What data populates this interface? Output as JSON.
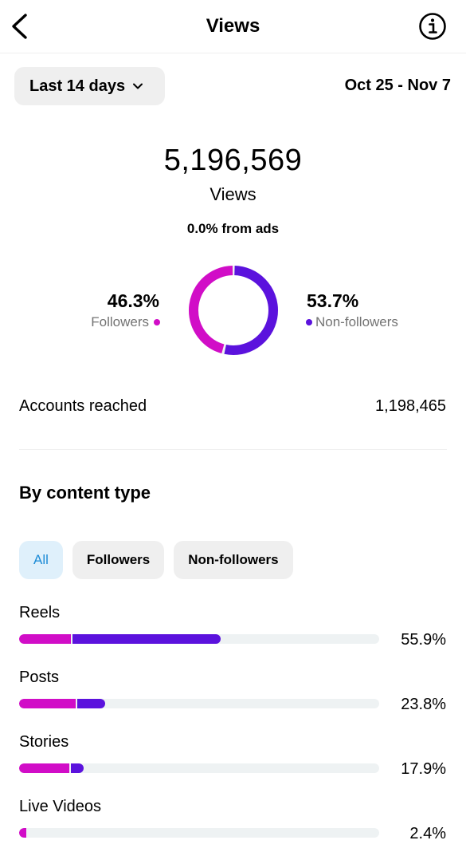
{
  "header": {
    "title": "Views",
    "back_icon": "chevron-left-icon",
    "info_icon": "info-icon"
  },
  "range": {
    "label": "Last 14 days",
    "dates": "Oct 25 - Nov 7"
  },
  "summary": {
    "total": "5,196,569",
    "label": "Views",
    "ads": "0.0% from ads"
  },
  "audience": {
    "followers": {
      "pct": "46.3%",
      "label": "Followers",
      "color": "#d10dc7"
    },
    "non_followers": {
      "pct": "53.7%",
      "label": "Non-followers",
      "color": "#5b12dd"
    }
  },
  "reach": {
    "label": "Accounts reached",
    "value": "1,198,465"
  },
  "content": {
    "title": "By content type",
    "filters": [
      "All",
      "Followers",
      "Non-followers"
    ],
    "active_filter": "All",
    "items": [
      {
        "label": "Reels",
        "pct": "55.9%",
        "followers_share": 14.4,
        "non_followers_share": 41.5
      },
      {
        "label": "Posts",
        "pct": "23.8%",
        "followers_share": 15.8,
        "non_followers_share": 8.0
      },
      {
        "label": "Stories",
        "pct": "17.9%",
        "followers_share": 13.9,
        "non_followers_share": 4.0
      },
      {
        "label": "Live Videos",
        "pct": "2.4%",
        "followers_share": 2.1,
        "non_followers_share": 0.3
      }
    ]
  }
}
